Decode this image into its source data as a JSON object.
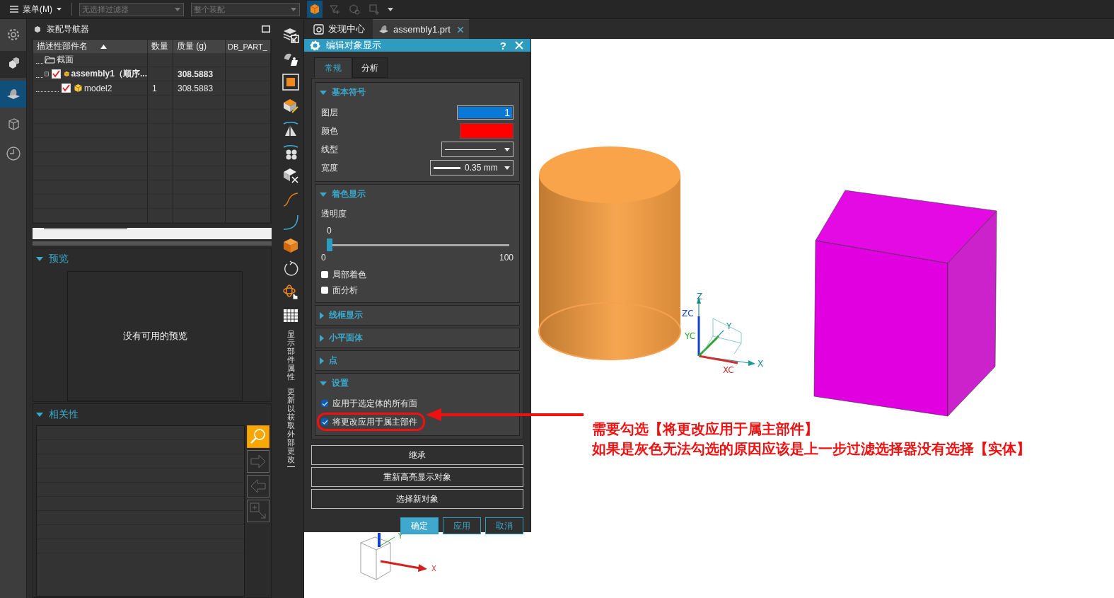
{
  "menu_bar": {
    "menu_label": "菜单(M)",
    "filter_placeholder": "无选择过滤器",
    "scope_placeholder": "整个装配"
  },
  "navigator": {
    "title": "装配导航器",
    "columns": [
      "描述性部件名",
      "数量",
      "质量 (g)",
      "DB_PART_"
    ],
    "rows": [
      {
        "kind": "folder",
        "name": "截面"
      },
      {
        "kind": "assembly",
        "name": "assembly1（顺序...",
        "checked": true,
        "expanded": true,
        "mass": "308.5883",
        "children": [
          {
            "kind": "part",
            "name": "model2",
            "checked": true,
            "quantity": "1",
            "mass": "308.5883"
          }
        ]
      }
    ]
  },
  "preview": {
    "title": "预览",
    "expanded": true,
    "empty_text": "没有可用的预览"
  },
  "dependencies": {
    "title": "相关性",
    "expanded": true
  },
  "side_toolbar": {
    "labels": [
      "显示部件属性",
      "更新以获取外部更改"
    ]
  },
  "doc_tabs": [
    {
      "label": "发现中心",
      "selected": false
    },
    {
      "label": "assembly1.prt",
      "selected": true
    }
  ],
  "dialog": {
    "title": "编辑对象显示",
    "help": "?",
    "tabs": [
      {
        "label": "常规",
        "selected": true
      },
      {
        "label": "分析",
        "selected": false
      }
    ],
    "sections": [
      {
        "kind": "symbols",
        "title": "基本符号",
        "expanded": true,
        "layer_label": "图层",
        "layer_value": "1",
        "color_label": "颜色",
        "color": "#ff0000",
        "linetype_label": "线型",
        "width_label": "宽度",
        "width_value": "0.35 mm"
      },
      {
        "kind": "shading",
        "title": "着色显示",
        "expanded": true,
        "transparency_label": "透明度",
        "transparency_value": "0",
        "level": 0,
        "min_label": "0",
        "max_label": "100",
        "options": [
          {
            "label": "局部着色",
            "checked": false
          },
          {
            "label": "面分析",
            "checked": false
          }
        ]
      },
      {
        "kind": "plain",
        "title": "线框显示",
        "expanded": false
      },
      {
        "kind": "plain",
        "title": "小平面体",
        "expanded": false
      },
      {
        "kind": "plain",
        "title": "点",
        "expanded": false
      },
      {
        "kind": "settings",
        "title": "设置",
        "expanded": true,
        "options": [
          {
            "label": "应用于选定体的所有面",
            "checked": true,
            "highlighted": false
          },
          {
            "label": "将更改应用于属主部件",
            "checked": true,
            "highlighted": true
          }
        ]
      }
    ],
    "action_buttons": [
      "继承",
      "重新高亮显示对象",
      "选择新对象"
    ],
    "footer_buttons": [
      {
        "label": "确定",
        "kind": "primary"
      },
      {
        "label": "应用",
        "kind": "secondary"
      },
      {
        "label": "取消",
        "kind": "secondary"
      }
    ]
  },
  "viewport": {
    "axis_labels": {
      "z": "Z",
      "zc": "ZC",
      "yc": "YC",
      "y": "Y",
      "xc": "XC",
      "x": "X"
    },
    "mini_axis_labels": {
      "y": "Y",
      "x": "X"
    }
  },
  "annotation": {
    "lines": [
      "需要勾选【将更改应用于属主部件】",
      "如果是灰色无法勾选的原因应该是上一步过滤选择器没有选择【实体】"
    ]
  }
}
